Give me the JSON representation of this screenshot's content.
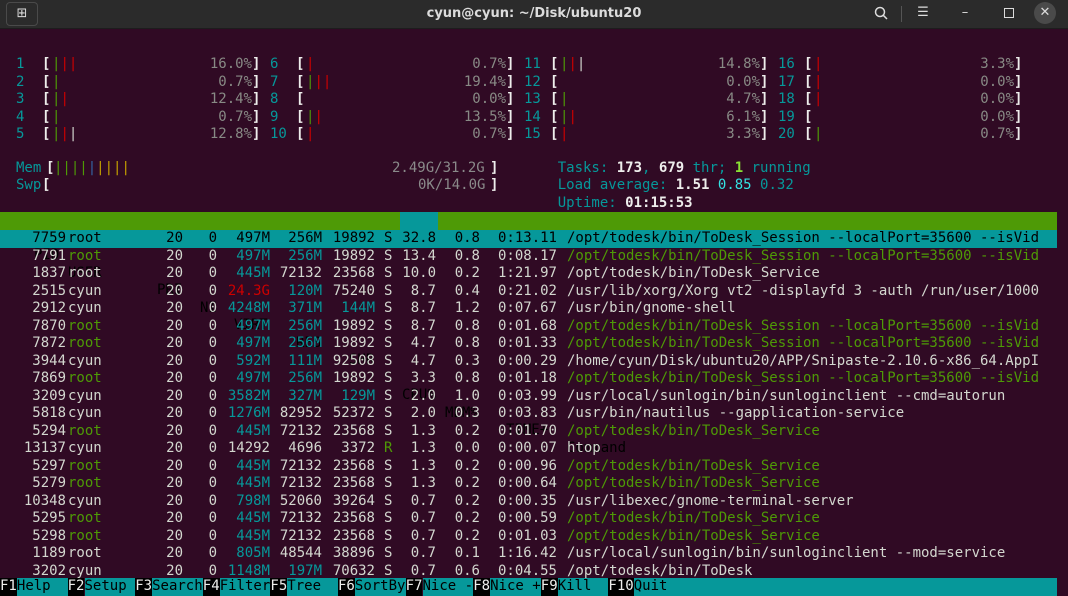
{
  "window": {
    "title": "cyun@cyun: ~/Disk/ubuntu20",
    "icons": {
      "new_tab": "new-tab-icon",
      "search": "search-icon",
      "menu": "hamburger-menu-icon",
      "minimize": "minimize-icon",
      "maximize": "maximize-icon",
      "close": "close-icon"
    }
  },
  "cpus": [
    {
      "n": "1",
      "value": "16.0%"
    },
    {
      "n": "2",
      "value": "0.7%"
    },
    {
      "n": "3",
      "value": "12.4%"
    },
    {
      "n": "4",
      "value": "0.7%"
    },
    {
      "n": "5",
      "value": "12.8%"
    },
    {
      "n": "6",
      "value": "0.7%"
    },
    {
      "n": "7",
      "value": "19.4%"
    },
    {
      "n": "8",
      "value": "0.0%"
    },
    {
      "n": "9",
      "value": "13.5%"
    },
    {
      "n": "10",
      "value": "0.7%"
    },
    {
      "n": "11",
      "value": "14.8%"
    },
    {
      "n": "12",
      "value": "0.0%"
    },
    {
      "n": "13",
      "value": "4.7%"
    },
    {
      "n": "14",
      "value": "6.1%"
    },
    {
      "n": "15",
      "value": "3.3%"
    },
    {
      "n": "16",
      "value": "3.3%"
    },
    {
      "n": "17",
      "value": "0.0%"
    },
    {
      "n": "18",
      "value": "0.0%"
    },
    {
      "n": "19",
      "value": "0.0%"
    },
    {
      "n": "20",
      "value": "0.7%"
    }
  ],
  "mem": {
    "label": "Mem",
    "value": "2.49G/31.2G"
  },
  "swp": {
    "label": "Swp",
    "value": "0K/14.0G"
  },
  "tasks": {
    "label": "Tasks: ",
    "tasks": "173",
    "sep": ", ",
    "threads": "679",
    "thr_label": " thr; ",
    "running": "1",
    "running_label": " running"
  },
  "load": {
    "label": "Load average: ",
    "l1": "1.51",
    "l5": "0.85",
    "l15": "0.32"
  },
  "uptime": {
    "label": "Uptime: ",
    "value": "01:15:53"
  },
  "columns": {
    "pid": "PID",
    "user": "USER",
    "pri": "PRI",
    "ni": "NI",
    "virt": "VIRT",
    "res": "RES",
    "shr": "SHR",
    "s": "S",
    "cpu": "CPU%",
    "mem": "MEM%",
    "time": "TIME+",
    "command": "Command"
  },
  "processes": [
    {
      "pid": "7759",
      "user": "root",
      "pri": "20",
      "ni": "0",
      "virt": "497M",
      "res": "256M",
      "shr": "19892",
      "s": "S",
      "cpu": "32.8",
      "mem": "0.8",
      "time": "0:13.11",
      "command": "/opt/todesk/bin/ToDesk_Session --localPort=35600 --isVid"
    },
    {
      "pid": "7791",
      "user": "root",
      "pri": "20",
      "ni": "0",
      "virt": "497M",
      "res": "256M",
      "shr": "19892",
      "s": "S",
      "cpu": "13.4",
      "mem": "0.8",
      "time": "0:08.17",
      "command": "/opt/todesk/bin/ToDesk_Session --localPort=35600 --isVid"
    },
    {
      "pid": "1837",
      "user": "root",
      "pri": "20",
      "ni": "0",
      "virt": "445M",
      "res": "72132",
      "shr": "23568",
      "s": "S",
      "cpu": "10.0",
      "mem": "0.2",
      "time": "1:21.97",
      "command": "/opt/todesk/bin/ToDesk_Service"
    },
    {
      "pid": "2515",
      "user": "cyun",
      "pri": "20",
      "ni": "0",
      "virt": "24.3G",
      "res": "120M",
      "shr": "75240",
      "s": "S",
      "cpu": "8.7",
      "mem": "0.4",
      "time": "0:21.02",
      "command": "/usr/lib/xorg/Xorg vt2 -displayfd 3 -auth /run/user/1000"
    },
    {
      "pid": "2912",
      "user": "cyun",
      "pri": "20",
      "ni": "0",
      "virt": "4248M",
      "res": "371M",
      "shr": "144M",
      "s": "S",
      "cpu": "8.7",
      "mem": "1.2",
      "time": "0:07.67",
      "command": "/usr/bin/gnome-shell"
    },
    {
      "pid": "7870",
      "user": "root",
      "pri": "20",
      "ni": "0",
      "virt": "497M",
      "res": "256M",
      "shr": "19892",
      "s": "S",
      "cpu": "8.7",
      "mem": "0.8",
      "time": "0:01.68",
      "command": "/opt/todesk/bin/ToDesk_Session --localPort=35600 --isVid"
    },
    {
      "pid": "7872",
      "user": "root",
      "pri": "20",
      "ni": "0",
      "virt": "497M",
      "res": "256M",
      "shr": "19892",
      "s": "S",
      "cpu": "4.7",
      "mem": "0.8",
      "time": "0:01.33",
      "command": "/opt/todesk/bin/ToDesk_Session --localPort=35600 --isVid"
    },
    {
      "pid": "3944",
      "user": "cyun",
      "pri": "20",
      "ni": "0",
      "virt": "592M",
      "res": "111M",
      "shr": "92508",
      "s": "S",
      "cpu": "4.7",
      "mem": "0.3",
      "time": "0:00.29",
      "command": "/home/cyun/Disk/ubuntu20/APP/Snipaste-2.10.6-x86_64.AppI"
    },
    {
      "pid": "7869",
      "user": "root",
      "pri": "20",
      "ni": "0",
      "virt": "497M",
      "res": "256M",
      "shr": "19892",
      "s": "S",
      "cpu": "3.3",
      "mem": "0.8",
      "time": "0:01.18",
      "command": "/opt/todesk/bin/ToDesk_Session --localPort=35600 --isVid"
    },
    {
      "pid": "3209",
      "user": "cyun",
      "pri": "20",
      "ni": "0",
      "virt": "3582M",
      "res": "327M",
      "shr": "129M",
      "s": "S",
      "cpu": "2.0",
      "mem": "1.0",
      "time": "0:03.99",
      "command": "/usr/local/sunlogin/bin/sunloginclient --cmd=autorun"
    },
    {
      "pid": "5818",
      "user": "cyun",
      "pri": "20",
      "ni": "0",
      "virt": "1276M",
      "res": "82952",
      "shr": "52372",
      "s": "S",
      "cpu": "2.0",
      "mem": "0.3",
      "time": "0:03.83",
      "command": "/usr/bin/nautilus --gapplication-service"
    },
    {
      "pid": "5294",
      "user": "root",
      "pri": "20",
      "ni": "0",
      "virt": "445M",
      "res": "72132",
      "shr": "23568",
      "s": "S",
      "cpu": "1.3",
      "mem": "0.2",
      "time": "0:01.70",
      "command": "/opt/todesk/bin/ToDesk_Service"
    },
    {
      "pid": "13137",
      "user": "cyun",
      "pri": "20",
      "ni": "0",
      "virt": "14292",
      "res": "4696",
      "shr": "3372",
      "s": "R",
      "cpu": "1.3",
      "mem": "0.0",
      "time": "0:00.07",
      "command": "htop"
    },
    {
      "pid": "5297",
      "user": "root",
      "pri": "20",
      "ni": "0",
      "virt": "445M",
      "res": "72132",
      "shr": "23568",
      "s": "S",
      "cpu": "1.3",
      "mem": "0.2",
      "time": "0:00.96",
      "command": "/opt/todesk/bin/ToDesk_Service"
    },
    {
      "pid": "5279",
      "user": "root",
      "pri": "20",
      "ni": "0",
      "virt": "445M",
      "res": "72132",
      "shr": "23568",
      "s": "S",
      "cpu": "1.3",
      "mem": "0.2",
      "time": "0:00.64",
      "command": "/opt/todesk/bin/ToDesk_Service"
    },
    {
      "pid": "10348",
      "user": "cyun",
      "pri": "20",
      "ni": "0",
      "virt": "798M",
      "res": "52060",
      "shr": "39264",
      "s": "S",
      "cpu": "0.7",
      "mem": "0.2",
      "time": "0:00.35",
      "command": "/usr/libexec/gnome-terminal-server"
    },
    {
      "pid": "5295",
      "user": "root",
      "pri": "20",
      "ni": "0",
      "virt": "445M",
      "res": "72132",
      "shr": "23568",
      "s": "S",
      "cpu": "0.7",
      "mem": "0.2",
      "time": "0:00.59",
      "command": "/opt/todesk/bin/ToDesk_Service"
    },
    {
      "pid": "5298",
      "user": "root",
      "pri": "20",
      "ni": "0",
      "virt": "445M",
      "res": "72132",
      "shr": "23568",
      "s": "S",
      "cpu": "0.7",
      "mem": "0.2",
      "time": "0:01.03",
      "command": "/opt/todesk/bin/ToDesk_Service"
    },
    {
      "pid": "1189",
      "user": "root",
      "pri": "20",
      "ni": "0",
      "virt": "805M",
      "res": "48544",
      "shr": "38896",
      "s": "S",
      "cpu": "0.7",
      "mem": "0.1",
      "time": "1:16.42",
      "command": "/usr/local/sunlogin/bin/sunloginclient --mod=service"
    },
    {
      "pid": "3202",
      "user": "cyun",
      "pri": "20",
      "ni": "0",
      "virt": "1148M",
      "res": "197M",
      "shr": "70632",
      "s": "S",
      "cpu": "0.7",
      "mem": "0.6",
      "time": "0:04.55",
      "command": "/opt/todesk/bin/ToDesk"
    }
  ],
  "footer": [
    {
      "key": "F1",
      "label": "Help"
    },
    {
      "key": "F2",
      "label": "Setup"
    },
    {
      "key": "F3",
      "label": "Search"
    },
    {
      "key": "F4",
      "label": "Filter"
    },
    {
      "key": "F5",
      "label": "Tree"
    },
    {
      "key": "F6",
      "label": "SortBy"
    },
    {
      "key": "F7",
      "label": "Nice -"
    },
    {
      "key": "F8",
      "label": "Nice +"
    },
    {
      "key": "F9",
      "label": "Kill"
    },
    {
      "key": "F10",
      "label": "Quit"
    }
  ]
}
